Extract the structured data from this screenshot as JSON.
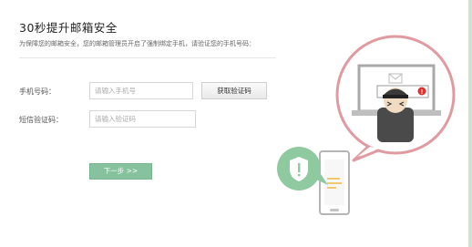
{
  "page": {
    "title": "30秒提升邮箱安全",
    "subtitle": "为保障您的邮箱安全，您的邮箱管理员开启了强制绑定手机，请验证您的手机号码："
  },
  "form": {
    "phone_label": "手机号码：",
    "phone_placeholder": "请输入手机号",
    "get_code_label": "获取验证码",
    "sms_label": "短信验证码：",
    "sms_placeholder": "请输入验证码",
    "next_label": "下一步 >>"
  },
  "illustration": {
    "icons": [
      "laptop-icon",
      "envelope-icon",
      "person-icon",
      "alert-icon",
      "shield-icon",
      "smartphone-icon"
    ],
    "colors": {
      "circle_border": "#e09aa0",
      "shield_bubble": "#8fc9a0",
      "alert": "#e03030",
      "accent_lines": "#f0b840"
    }
  },
  "colors": {
    "next_button": "#86c29d",
    "right_border": "#cfe3cf"
  }
}
